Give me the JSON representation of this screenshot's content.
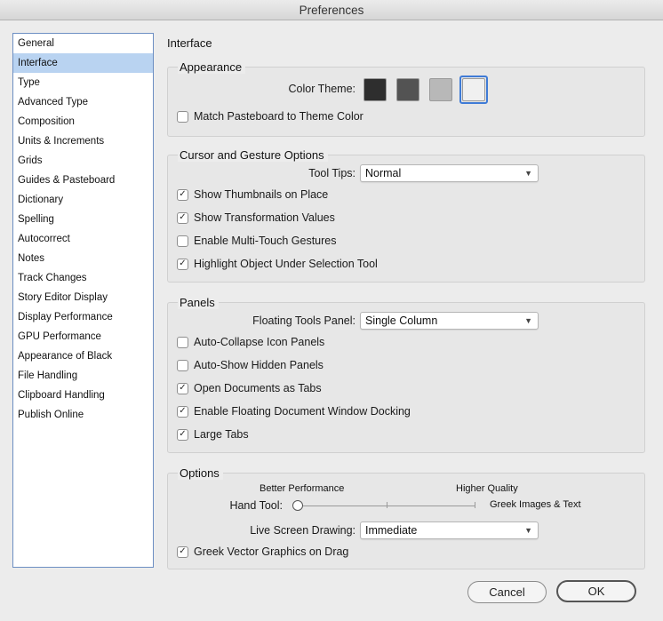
{
  "window": {
    "title": "Preferences"
  },
  "sidebar": {
    "items": [
      {
        "label": "General"
      },
      {
        "label": "Interface",
        "selected": true
      },
      {
        "label": "Type"
      },
      {
        "label": "Advanced Type"
      },
      {
        "label": "Composition"
      },
      {
        "label": "Units & Increments"
      },
      {
        "label": "Grids"
      },
      {
        "label": "Guides & Pasteboard"
      },
      {
        "label": "Dictionary"
      },
      {
        "label": "Spelling"
      },
      {
        "label": "Autocorrect"
      },
      {
        "label": "Notes"
      },
      {
        "label": "Track Changes"
      },
      {
        "label": "Story Editor Display"
      },
      {
        "label": "Display Performance"
      },
      {
        "label": "GPU Performance"
      },
      {
        "label": "Appearance of Black"
      },
      {
        "label": "File Handling"
      },
      {
        "label": "Clipboard Handling"
      },
      {
        "label": "Publish Online"
      }
    ]
  },
  "main": {
    "title": "Interface",
    "appearance": {
      "title": "Appearance",
      "color_theme_label": "Color Theme:",
      "themes": [
        {
          "name": "dark",
          "color": "#2e2e2e"
        },
        {
          "name": "medium-dark",
          "color": "#535353"
        },
        {
          "name": "medium-light",
          "color": "#b8b8b8",
          "selected": false
        },
        {
          "name": "light",
          "color": "#f0f0f0",
          "selected": true
        }
      ],
      "match_pasteboard": {
        "label": "Match Pasteboard to Theme Color",
        "checked": false
      }
    },
    "cursor": {
      "title": "Cursor and Gesture Options",
      "tool_tips_label": "Tool Tips:",
      "tool_tips_value": "Normal",
      "checkboxes": [
        {
          "label": "Show Thumbnails on Place",
          "checked": true
        },
        {
          "label": "Show Transformation Values",
          "checked": true
        },
        {
          "label": "Enable Multi-Touch Gestures",
          "checked": false
        },
        {
          "label": "Highlight Object Under Selection Tool",
          "checked": true
        }
      ]
    },
    "panels": {
      "title": "Panels",
      "floating_label": "Floating Tools Panel:",
      "floating_value": "Single Column",
      "checkboxes": [
        {
          "label": "Auto-Collapse Icon Panels",
          "checked": false
        },
        {
          "label": "Auto-Show Hidden Panels",
          "checked": false
        },
        {
          "label": "Open Documents as Tabs",
          "checked": true
        },
        {
          "label": "Enable Floating Document Window Docking",
          "checked": true
        },
        {
          "label": "Large Tabs",
          "checked": true
        }
      ]
    },
    "options": {
      "title": "Options",
      "better_performance": "Better Performance",
      "higher_quality": "Higher Quality",
      "hand_tool_label": "Hand Tool:",
      "hand_tool_value_label": "Greek Images & Text",
      "hand_tool_position": 0,
      "live_drawing_label": "Live Screen Drawing:",
      "live_drawing_value": "Immediate",
      "greek_vector": {
        "label": "Greek Vector Graphics on Drag",
        "checked": true
      }
    }
  },
  "footer": {
    "cancel_label": "Cancel",
    "ok_label": "OK"
  },
  "icons": {
    "check": "checkmark-icon",
    "chevron": "chevron-updown-icon"
  }
}
